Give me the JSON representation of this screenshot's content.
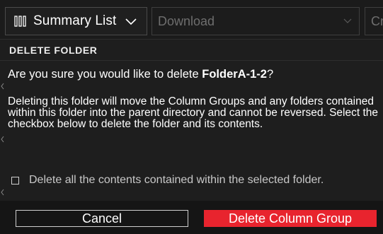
{
  "toolbar": {
    "view_select": {
      "label": "Summary List",
      "icon": "columns-icon"
    },
    "download_select": {
      "placeholder": "Download"
    },
    "next_select": {
      "label": "Cr"
    }
  },
  "dialog": {
    "title": "DELETE FOLDER",
    "question_prefix": "Are you sure you would like to delete ",
    "folder_name": "FolderA-1-2",
    "question_suffix": "?",
    "description": "Deleting this folder will move the Column Groups and any folders contained within this folder into the parent directory and cannot be reversed. Select the checkbox below to delete the folder and its contents.",
    "checkbox_label": "Delete all the contents contained within the selected folder.",
    "checkbox_checked": false,
    "cancel_label": "Cancel",
    "delete_label": "Delete Column Group"
  },
  "colors": {
    "background": "#1e1e1e",
    "footer": "#151515",
    "danger": "#e8242e",
    "muted_text": "#6e6e6e"
  }
}
